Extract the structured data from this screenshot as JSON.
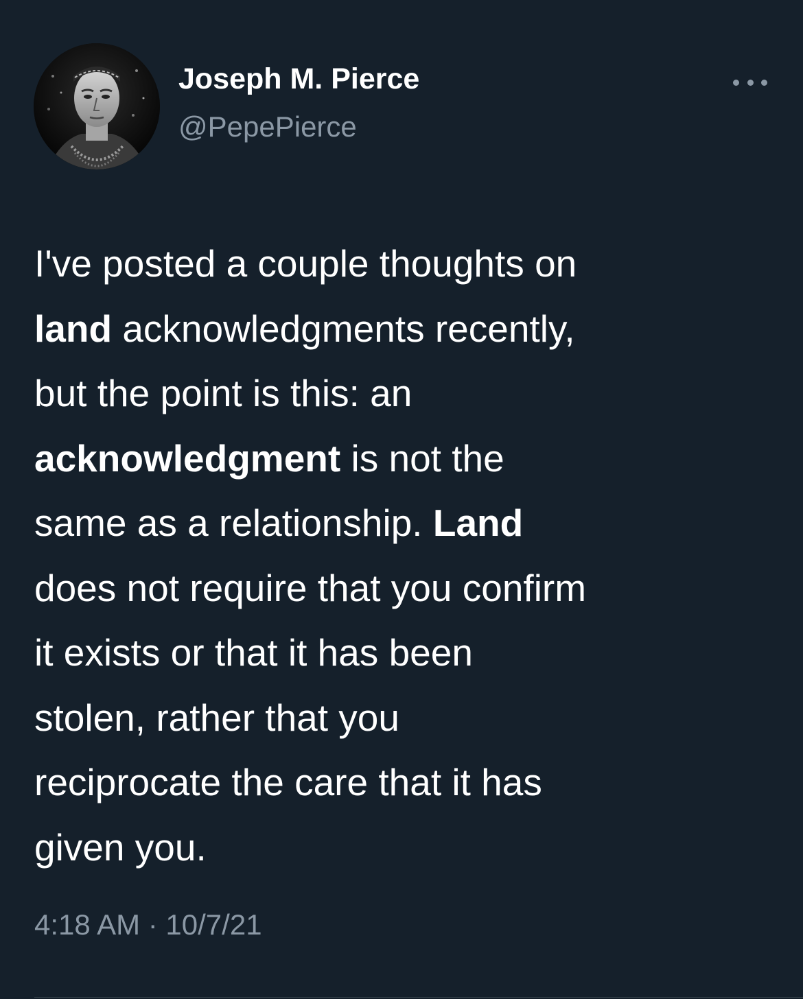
{
  "author": {
    "name": "Joseph M. Pierce",
    "handle": "@PepePierce",
    "avatar_icon": "profile-photo-avatar"
  },
  "menu": {
    "icon": "more-options-icon"
  },
  "tweet": {
    "line1": "I've posted a couple thoughts on",
    "s1": "land",
    "s2": " acknowledgments recently,",
    "s3": "but the point is this: an",
    "s4": "acknowledgment",
    "s5": " is not the",
    "s6": "same as a relationship. ",
    "s7": "Land",
    "s8": "does not require that you confirm",
    "s9": "it exists or that it has been",
    "s10": "stolen, rather that you",
    "s11": "reciprocate the care that it has",
    "s12": "given you."
  },
  "meta": {
    "timestamp": "4:18 AM · 10/7/21"
  },
  "colors": {
    "background": "#15202b",
    "primary_text": "#ffffff",
    "secondary_text": "#8b98a5",
    "divider": "#38444d"
  }
}
